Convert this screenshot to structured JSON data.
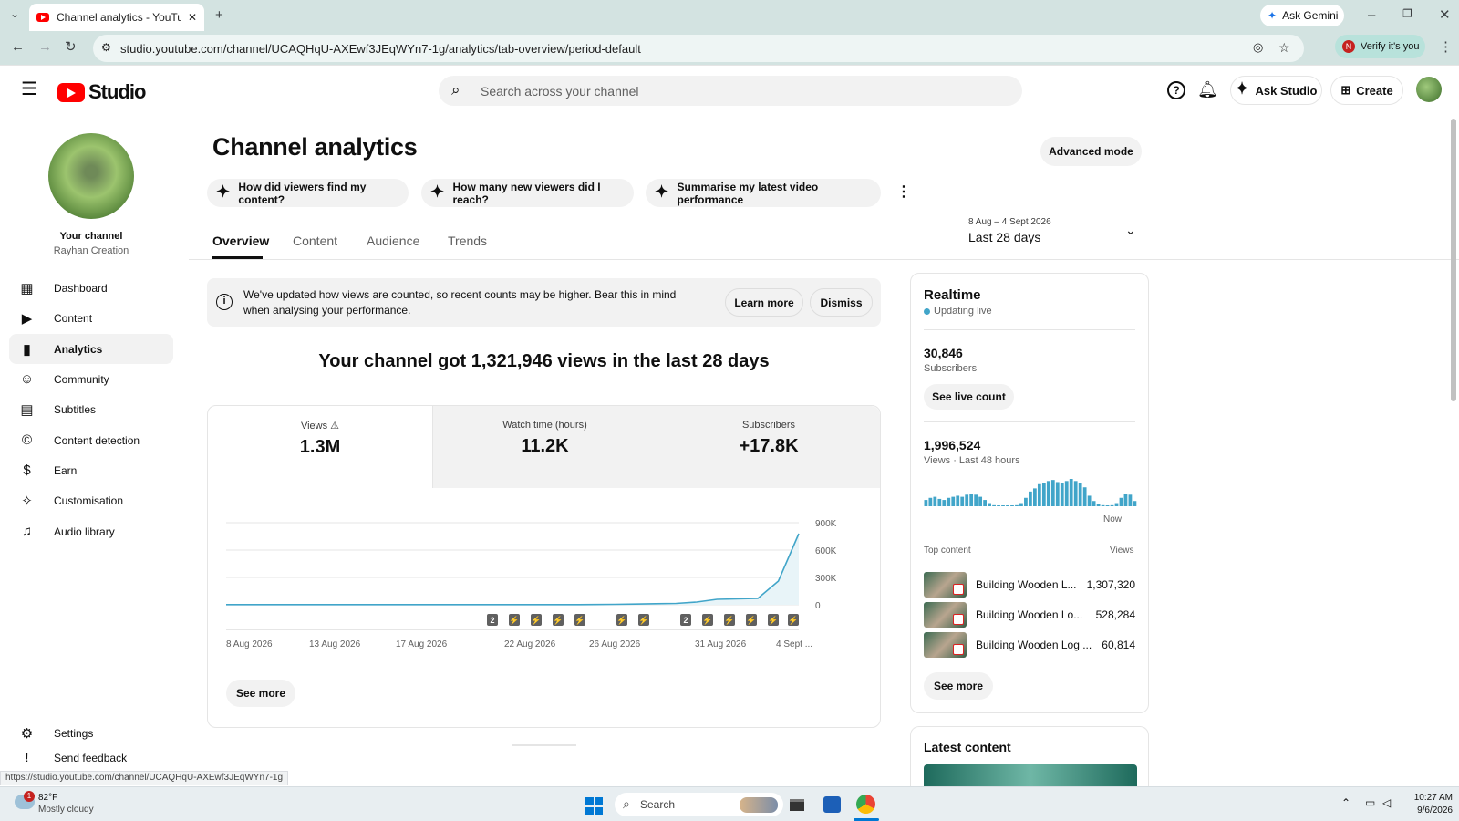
{
  "browser": {
    "tab_title": "Channel analytics - YouTube St",
    "url": "studio.youtube.com/channel/UCAQHqU-AXEwf3JEqWYn7-1g/analytics/tab-overview/period-default",
    "ask_gemini": "Ask Gemini",
    "verify": "Verify it's you",
    "verify_badge": "N",
    "status_url": "https://studio.youtube.com/channel/UCAQHqU-AXEwf3JEqWYn7-1g"
  },
  "header": {
    "logo_text": "Studio",
    "search_placeholder": "Search across your channel",
    "ask_studio": "Ask Studio",
    "create": "Create"
  },
  "sidebar": {
    "your_channel": "Your channel",
    "channel_name": "Rayhan Creation",
    "items": [
      {
        "label": "Dashboard",
        "icon": "dashboard-icon"
      },
      {
        "label": "Content",
        "icon": "content-icon"
      },
      {
        "label": "Analytics",
        "icon": "analytics-icon"
      },
      {
        "label": "Community",
        "icon": "community-icon"
      },
      {
        "label": "Subtitles",
        "icon": "subtitles-icon"
      },
      {
        "label": "Content detection",
        "icon": "copyright-icon"
      },
      {
        "label": "Earn",
        "icon": "dollar-icon"
      },
      {
        "label": "Customisation",
        "icon": "wand-icon"
      },
      {
        "label": "Audio library",
        "icon": "audio-library-icon"
      }
    ],
    "settings": "Settings",
    "feedback": "Send feedback"
  },
  "main": {
    "title": "Channel analytics",
    "advanced_mode": "Advanced mode",
    "chips": [
      "How did viewers find my content?",
      "How many new viewers did I reach?",
      "Summarise my latest video performance"
    ],
    "tabs": [
      "Overview",
      "Content",
      "Audience",
      "Trends"
    ],
    "date_range": "8 Aug – 4 Sept 2026",
    "period": "Last 28 days",
    "notice": "We've updated how views are counted, so recent counts may be higher. Bear this in mind when analysing your performance.",
    "learn_more": "Learn more",
    "dismiss": "Dismiss",
    "headline": "Your channel got 1,321,946 views in the last 28 days",
    "metrics": [
      {
        "label": "Views",
        "value": "1.3M"
      },
      {
        "label": "Watch time (hours)",
        "value": "11.2K"
      },
      {
        "label": "Subscribers",
        "value": "+17.8K"
      }
    ],
    "see_more": "See more"
  },
  "chart_data": {
    "type": "line",
    "x_labels": [
      "8 Aug 2026",
      "13 Aug 2026",
      "17 Aug 2026",
      "22 Aug 2026",
      "26 Aug 2026",
      "31 Aug 2026",
      "4 Sept ..."
    ],
    "y_ticks": [
      "900K",
      "600K",
      "300K",
      "0"
    ],
    "ylim": [
      0,
      900000
    ],
    "values": [
      2000,
      2000,
      2000,
      2000,
      2000,
      2000,
      2000,
      2000,
      2000,
      2000,
      2000,
      2000,
      2000,
      2000,
      2000,
      2000,
      2000,
      2000,
      3000,
      5000,
      8000,
      12000,
      15000,
      30000,
      60000,
      65000,
      70000,
      260000,
      780000
    ],
    "marker_count_2": "2",
    "series_color": "#41a5c9"
  },
  "realtime": {
    "title": "Realtime",
    "updating": "Updating live",
    "subscribers_value": "30,846",
    "subscribers_label": "Subscribers",
    "see_live": "See live count",
    "views_value": "1,996,524",
    "views_label": "Views · Last 48 hours",
    "now": "Now",
    "bars": [
      6,
      8,
      9,
      7,
      6,
      8,
      9,
      10,
      9,
      11,
      12,
      11,
      9,
      6,
      3,
      1,
      0,
      0,
      0,
      0,
      1,
      3,
      8,
      14,
      17,
      21,
      22,
      24,
      25,
      23,
      22,
      24,
      26,
      24,
      22,
      18,
      10,
      5,
      2,
      1,
      0,
      1,
      3,
      8,
      12,
      11,
      5
    ],
    "top_content": "Top content",
    "views_header": "Views",
    "items": [
      {
        "title": "Building Wooden L...",
        "views": "1,307,320"
      },
      {
        "title": "Building Wooden Lo...",
        "views": "528,284"
      },
      {
        "title": "Building Wooden Log ...",
        "views": "60,814"
      }
    ],
    "see_more": "See more",
    "latest": "Latest content"
  },
  "taskbar": {
    "temp": "82°F",
    "weather": "Mostly cloudy",
    "weather_badge": "1",
    "search": "Search",
    "time": "10:27 AM",
    "date": "9/6/2026"
  }
}
